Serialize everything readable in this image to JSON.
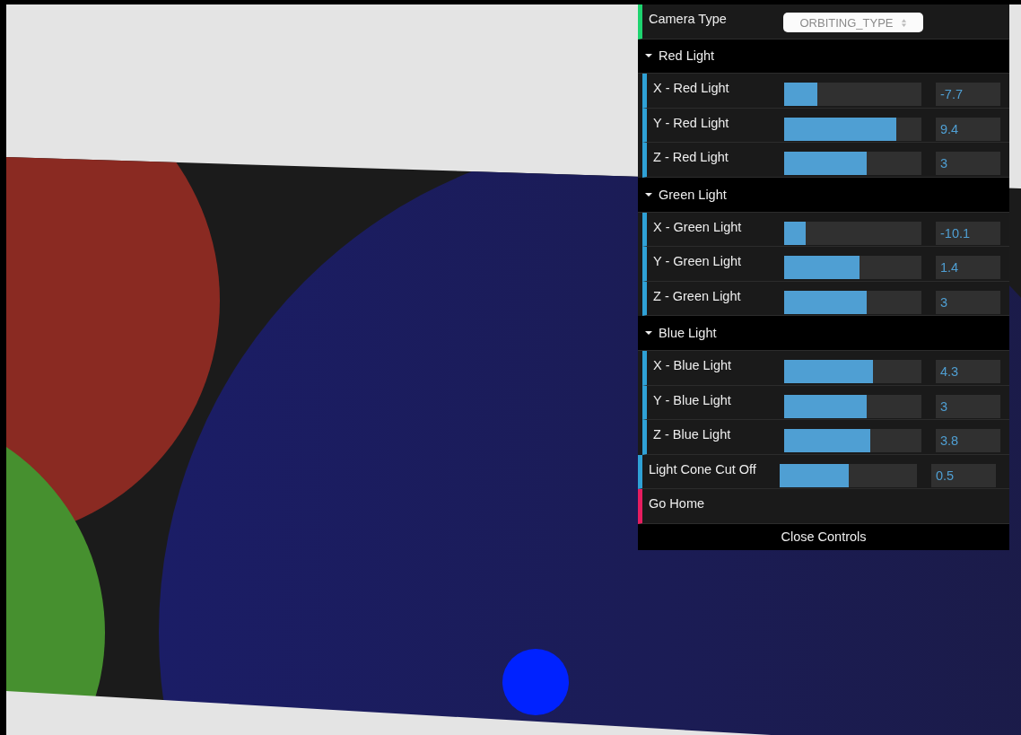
{
  "controls": [
    {
      "kind": "select",
      "label": "Camera Type",
      "value": "ORBITING_TYPE"
    },
    {
      "kind": "folder",
      "title": "Red Light",
      "expanded": true,
      "children": [
        {
          "kind": "slider",
          "label": "X - Red Light",
          "level": 0.24,
          "value": "-7.7"
        },
        {
          "kind": "slider",
          "label": "Y - Red Light",
          "level": 0.82,
          "value": "9.4"
        },
        {
          "kind": "slider",
          "label": "Z - Red Light",
          "level": 0.6,
          "value": "3"
        }
      ]
    },
    {
      "kind": "folder",
      "title": "Green Light",
      "expanded": true,
      "children": [
        {
          "kind": "slider",
          "label": "X - Green Light",
          "level": 0.16,
          "value": "-10.1"
        },
        {
          "kind": "slider",
          "label": "Y - Green Light",
          "level": 0.55,
          "value": "1.4"
        },
        {
          "kind": "slider",
          "label": "Z - Green Light",
          "level": 0.6,
          "value": "3"
        }
      ]
    },
    {
      "kind": "folder",
      "title": "Blue Light",
      "expanded": true,
      "children": [
        {
          "kind": "slider",
          "label": "X - Blue Light",
          "level": 0.65,
          "value": "4.3"
        },
        {
          "kind": "slider",
          "label": "Y - Blue Light",
          "level": 0.6,
          "value": "3"
        },
        {
          "kind": "slider",
          "label": "Z - Blue Light",
          "level": 0.63,
          "value": "3.8"
        }
      ]
    },
    {
      "kind": "slider",
      "label": "Light Cone Cut Off",
      "level": 0.5,
      "value": "0.5"
    },
    {
      "kind": "button",
      "label": "Go Home"
    }
  ],
  "close_label": "Close Controls"
}
